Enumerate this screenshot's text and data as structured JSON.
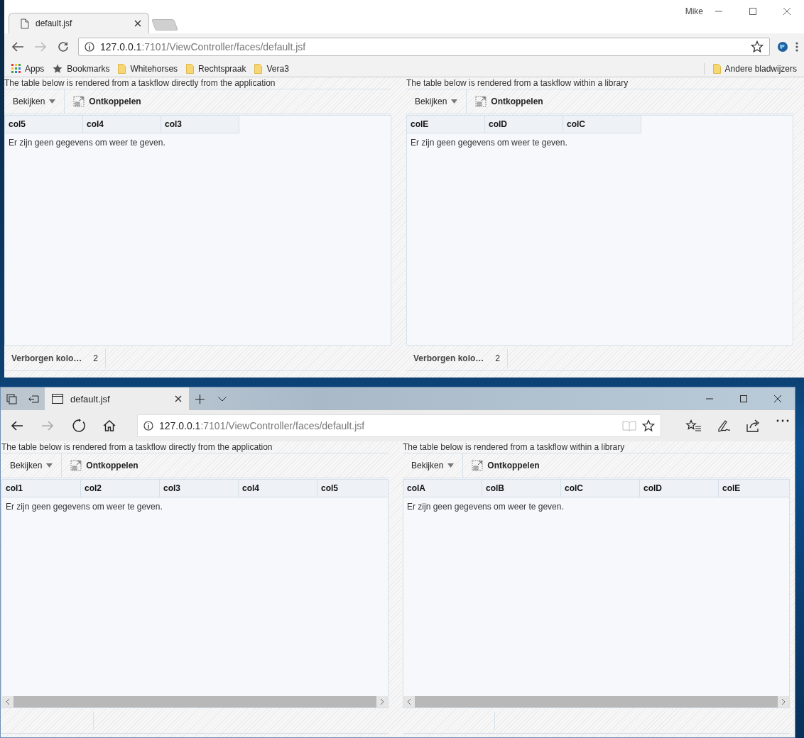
{
  "windows": [
    {
      "kind": "chrome",
      "tab": {
        "title": "default.jsf"
      },
      "user": "Mike",
      "url_host": "127.0.0.1",
      "url_path": ":7101/ViewController/faces/default.jsf",
      "bookmarks": [
        {
          "kind": "apps",
          "label": "Apps"
        },
        {
          "kind": "star",
          "label": "Bookmarks"
        },
        {
          "kind": "folder",
          "label": "Whitehorses"
        },
        {
          "kind": "folder",
          "label": "Rechtspraak"
        },
        {
          "kind": "folder",
          "label": "Vera3"
        }
      ],
      "other_bookmarks": "Andere bladwijzers",
      "panels": [
        {
          "caption": "The table below is rendered from a taskflow directly from the application",
          "view_menu": "Bekijken",
          "detach": "Ontkoppelen",
          "columns": [
            "col5",
            "col4",
            "col3"
          ],
          "empty_message": "Er zijn geen gegevens om weer te geven.",
          "horizontal_scrollbar": false,
          "footer": {
            "label": "Verborgen kolo…",
            "count": "2"
          }
        },
        {
          "caption": "The table below is rendered from a taskflow within a library",
          "view_menu": "Bekijken",
          "detach": "Ontkoppelen",
          "columns": [
            "colE",
            "colD",
            "colC"
          ],
          "empty_message": "Er zijn geen gegevens om weer te geven.",
          "horizontal_scrollbar": false,
          "footer": {
            "label": "Verborgen kolo…",
            "count": "2"
          }
        }
      ]
    },
    {
      "kind": "edge",
      "tab": {
        "title": "default.jsf"
      },
      "url_host": "127.0.0.1",
      "url_path": ":7101/ViewController/faces/default.jsf",
      "panels": [
        {
          "caption": "The table below is rendered from a taskflow directly from the application",
          "view_menu": "Bekijken",
          "detach": "Ontkoppelen",
          "columns": [
            "col1",
            "col2",
            "col3",
            "col4",
            "col5"
          ],
          "empty_message": "Er zijn geen gegevens om weer te geven.",
          "horizontal_scrollbar": true
        },
        {
          "caption": "The table below is rendered from a taskflow within a library",
          "view_menu": "Bekijken",
          "detach": "Ontkoppelen",
          "columns": [
            "colA",
            "colB",
            "colC",
            "colD",
            "colE"
          ],
          "empty_message": "Er zijn geen gegevens om weer te geven.",
          "horizontal_scrollbar": true
        }
      ]
    }
  ]
}
